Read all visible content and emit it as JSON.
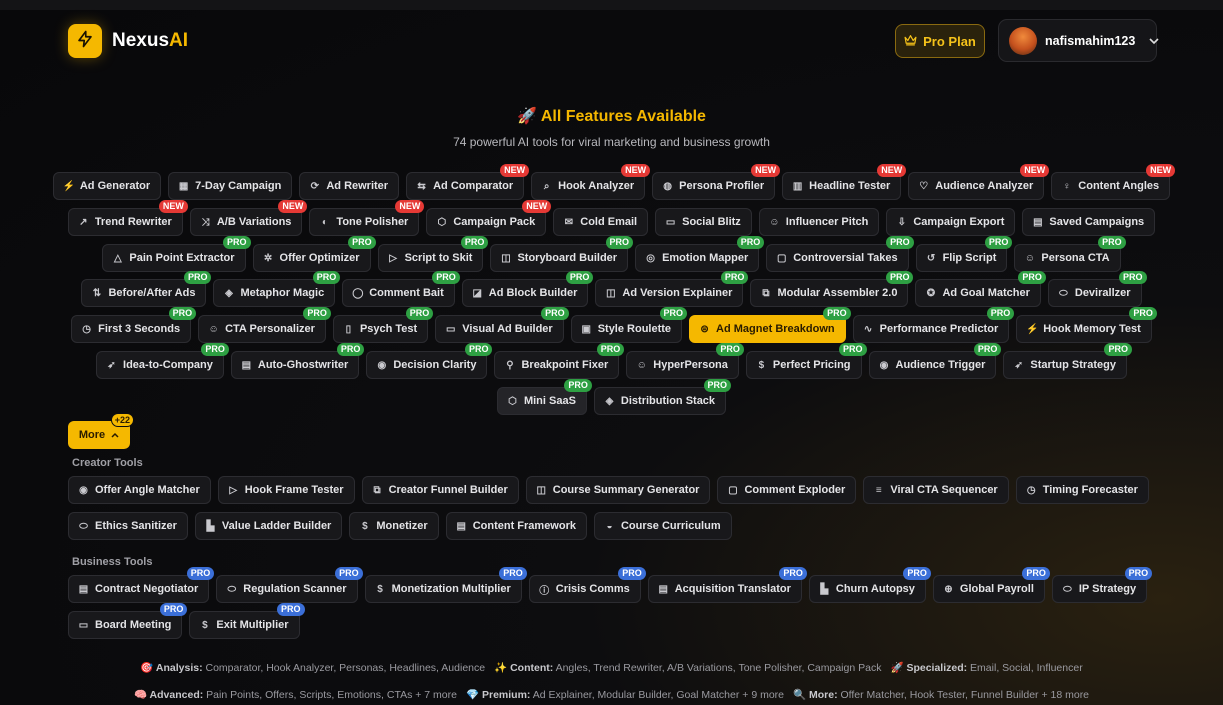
{
  "header": {
    "brand_main": "Nexus",
    "brand_ai": "AI",
    "plan_label": "Pro Plan",
    "username": "nafismahim123"
  },
  "hero": {
    "title": "🚀 All Features Available",
    "subtitle": "74 powerful AI tools for viral marketing and business growth"
  },
  "rows": [
    [
      {
        "label": "Ad Generator",
        "icon": "⚡"
      },
      {
        "label": "7-Day Campaign",
        "icon": "▦"
      },
      {
        "label": "Ad Rewriter",
        "icon": "⟳"
      },
      {
        "label": "Ad Comparator",
        "icon": "⇆",
        "badge": "NEW"
      },
      {
        "label": "Hook Analyzer",
        "icon": "⌕",
        "badge": "NEW"
      },
      {
        "label": "Persona Profiler",
        "icon": "◍",
        "badge": "NEW"
      },
      {
        "label": "Headline Tester",
        "icon": "▥",
        "badge": "NEW"
      },
      {
        "label": "Audience Analyzer",
        "icon": "♡",
        "badge": "NEW"
      },
      {
        "label": "Content Angles",
        "icon": "♀",
        "badge": "NEW"
      }
    ],
    [
      {
        "label": "Trend Rewriter",
        "icon": "↗",
        "badge": "NEW"
      },
      {
        "label": "A/B Variations",
        "icon": "⤨",
        "badge": "NEW"
      },
      {
        "label": "Tone Polisher",
        "icon": "◐",
        "badge": "NEW"
      },
      {
        "label": "Campaign Pack",
        "icon": "⬡",
        "badge": "NEW"
      },
      {
        "label": "Cold Email",
        "icon": "✉"
      },
      {
        "label": "Social Blitz",
        "icon": "▭"
      },
      {
        "label": "Influencer Pitch",
        "icon": "☺"
      },
      {
        "label": "Campaign Export",
        "icon": "⇩"
      },
      {
        "label": "Saved Campaigns",
        "icon": "▤"
      }
    ],
    [
      {
        "label": "Pain Point Extractor",
        "icon": "△",
        "badge": "PRO"
      },
      {
        "label": "Offer Optimizer",
        "icon": "✲",
        "badge": "PRO"
      },
      {
        "label": "Script to Skit",
        "icon": "▷",
        "badge": "PRO"
      },
      {
        "label": "Storyboard Builder",
        "icon": "◫",
        "badge": "PRO"
      },
      {
        "label": "Emotion Mapper",
        "icon": "◎",
        "badge": "PRO"
      },
      {
        "label": "Controversial Takes",
        "icon": "▢",
        "badge": "PRO"
      },
      {
        "label": "Flip Script",
        "icon": "↺",
        "badge": "PRO"
      },
      {
        "label": "Persona CTA",
        "icon": "☺",
        "badge": "PRO"
      }
    ],
    [
      {
        "label": "Before/After Ads",
        "icon": "⇅",
        "badge": "PRO"
      },
      {
        "label": "Metaphor Magic",
        "icon": "◈",
        "badge": "PRO"
      },
      {
        "label": "Comment Bait",
        "icon": "◯",
        "badge": "PRO"
      },
      {
        "label": "Ad Block Builder",
        "icon": "◪",
        "badge": "PRO"
      },
      {
        "label": "Ad Version Explainer",
        "icon": "◫",
        "badge": "PRO"
      },
      {
        "label": "Modular Assembler 2.0",
        "icon": "⧉",
        "badge": "PRO"
      },
      {
        "label": "Ad Goal Matcher",
        "icon": "✪",
        "badge": "PRO"
      },
      {
        "label": "Devirallzer",
        "icon": "⬭",
        "badge": "PRO"
      }
    ],
    [
      {
        "label": "First 3 Seconds",
        "icon": "◷",
        "badge": "PRO"
      },
      {
        "label": "CTA Personalizer",
        "icon": "☺",
        "badge": "PRO"
      },
      {
        "label": "Psych Test",
        "icon": "▯",
        "badge": "PRO"
      },
      {
        "label": "Visual Ad Builder",
        "icon": "▭",
        "badge": "PRO"
      },
      {
        "label": "Style Roulette",
        "icon": "▣",
        "badge": "PRO"
      },
      {
        "label": "Ad Magnet Breakdown",
        "icon": "⊜",
        "badge": "PRO",
        "selected": true
      },
      {
        "label": "Performance Predictor",
        "icon": "∿",
        "badge": "PRO"
      },
      {
        "label": "Hook Memory Test",
        "icon": "⚡",
        "badge": "PRO"
      }
    ],
    [
      {
        "label": "Idea-to-Company",
        "icon": "➶",
        "badge": "PRO"
      },
      {
        "label": "Auto-Ghostwriter",
        "icon": "▤",
        "badge": "PRO"
      },
      {
        "label": "Decision Clarity",
        "icon": "◉",
        "badge": "PRO"
      },
      {
        "label": "Breakpoint Fixer",
        "icon": "⚲",
        "badge": "PRO"
      },
      {
        "label": "HyperPersona",
        "icon": "☺",
        "badge": "PRO"
      },
      {
        "label": "Perfect Pricing",
        "icon": "$",
        "badge": "PRO"
      },
      {
        "label": "Audience Trigger",
        "icon": "◉",
        "badge": "PRO"
      },
      {
        "label": "Startup Strategy",
        "icon": "➶",
        "badge": "PRO"
      }
    ],
    [
      {
        "label": "Mini SaaS",
        "icon": "⬡",
        "badge": "PRO",
        "dark": true
      },
      {
        "label": "Distribution Stack",
        "icon": "◈",
        "badge": "PRO"
      }
    ]
  ],
  "more": {
    "label": "More",
    "count": "+22"
  },
  "creator": {
    "title": "Creator Tools",
    "rows": [
      [
        {
          "label": "Offer Angle Matcher",
          "icon": "◉"
        },
        {
          "label": "Hook Frame Tester",
          "icon": "▷"
        },
        {
          "label": "Creator Funnel Builder",
          "icon": "⧉"
        },
        {
          "label": "Course Summary Generator",
          "icon": "◫"
        },
        {
          "label": "Comment Exploder",
          "icon": "▢"
        },
        {
          "label": "Viral CTA Sequencer",
          "icon": "≡"
        },
        {
          "label": "Timing Forecaster",
          "icon": "◷"
        }
      ],
      [
        {
          "label": "Ethics Sanitizer",
          "icon": "⬭"
        },
        {
          "label": "Value Ladder Builder",
          "icon": "▙"
        },
        {
          "label": "Monetizer",
          "icon": "$"
        },
        {
          "label": "Content Framework",
          "icon": "▤"
        },
        {
          "label": "Course Curriculum",
          "icon": "◒"
        }
      ]
    ]
  },
  "business": {
    "title": "Business Tools",
    "rows": [
      [
        {
          "label": "Contract Negotiator",
          "icon": "▤",
          "badge": "PRO"
        },
        {
          "label": "Regulation Scanner",
          "icon": "⬭",
          "badge": "PRO"
        },
        {
          "label": "Monetization Multiplier",
          "icon": "$",
          "badge": "PRO"
        },
        {
          "label": "Crisis Comms",
          "icon": "ⓘ",
          "badge": "PRO"
        },
        {
          "label": "Acquisition Translator",
          "icon": "▤",
          "badge": "PRO"
        },
        {
          "label": "Churn Autopsy",
          "icon": "▙",
          "badge": "PRO"
        },
        {
          "label": "Global Payroll",
          "icon": "⊕",
          "badge": "PRO"
        },
        {
          "label": "IP Strategy",
          "icon": "⬭",
          "badge": "PRO"
        }
      ],
      [
        {
          "label": "Board Meeting",
          "icon": "▭",
          "badge": "PRO"
        },
        {
          "label": "Exit Multiplier",
          "icon": "$",
          "badge": "PRO"
        }
      ]
    ]
  },
  "footer": {
    "line1": [
      {
        "k": "🎯 Analysis:",
        "v": " Comparator, Hook Analyzer, Personas, Headlines, Audience"
      },
      {
        "k": "✨ Content:",
        "v": " Angles, Trend Rewriter, A/B Variations, Tone Polisher, Campaign Pack"
      },
      {
        "k": "🚀 Specialized:",
        "v": " Email, Social, Influencer"
      }
    ],
    "line2": [
      {
        "k": "🧠 Advanced:",
        "v": " Pain Points, Offers, Scripts, Emotions, CTAs + 7 more"
      },
      {
        "k": "💎 Premium:",
        "v": " Ad Explainer, Modular Builder, Goal Matcher + 9 more"
      },
      {
        "k": "🔍 More:",
        "v": " Offer Matcher, Hook Tester, Funnel Builder + 18 more"
      }
    ]
  }
}
